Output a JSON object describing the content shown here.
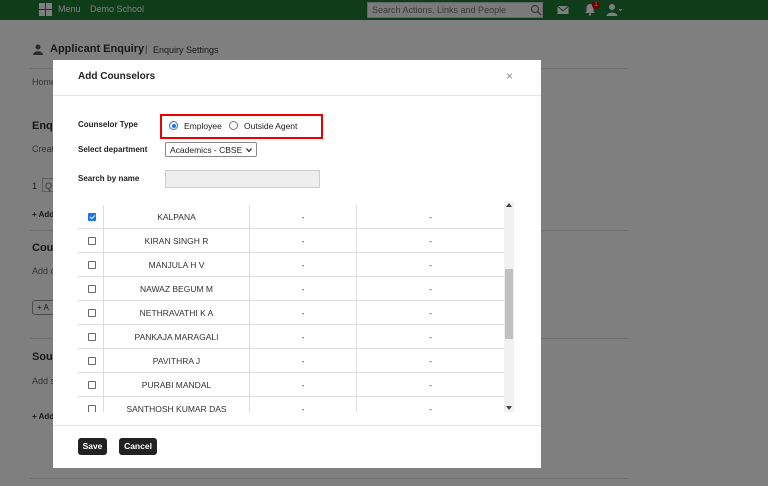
{
  "topbar": {
    "menu_label": "Menu",
    "school_name": "Demo School",
    "search_placeholder": "Search Actions, Links and People",
    "notification_count": "1",
    "accent_color": "#1e7a32"
  },
  "background": {
    "page_title": "Applicant Enquiry",
    "separator": "|",
    "page_subtitle": "Enquiry Settings",
    "breadcrumb": "Home",
    "section1_heading": "Enqu",
    "section1_text": "Creat",
    "row_number": "1",
    "row_box_text": "Q",
    "add_link1": "+ Add",
    "section2_heading": "Cour",
    "section2_text": "Add c",
    "button_text": "+ A",
    "section3_heading": "Sour",
    "section3_text": "Add s",
    "add_link2": "+ Add"
  },
  "modal": {
    "title": "Add Counselors",
    "close_symbol": "×",
    "counselor_type_label": "Counselor Type",
    "type_options": [
      {
        "label": "Employee",
        "selected": true
      },
      {
        "label": "Outside Agent",
        "selected": false
      }
    ],
    "department_label": "Select department",
    "department_value": "Academics - CBSE",
    "search_label": "Search by name",
    "search_value": "",
    "rows": [
      {
        "name": "KALPANA",
        "col2": "-",
        "col3": "-",
        "checked": true
      },
      {
        "name": "KIRAN SINGH R",
        "col2": "-",
        "col3": "-",
        "checked": false
      },
      {
        "name": "MANJULA H V",
        "col2": "-",
        "col3": "-",
        "checked": false
      },
      {
        "name": "NAWAZ BEGUM M",
        "col2": "-",
        "col3": "-",
        "checked": false
      },
      {
        "name": "NETHRAVATHI K A",
        "col2": "-",
        "col3": "-",
        "checked": false
      },
      {
        "name": "PANKAJA MARAGALI",
        "col2": "-",
        "col3": "-",
        "checked": false
      },
      {
        "name": "PAVITHRA J",
        "col2": "-",
        "col3": "-",
        "checked": false
      },
      {
        "name": "PURABI MANDAL",
        "col2": "-",
        "col3": "-",
        "checked": false
      },
      {
        "name": "SANTHOSH KUMAR DAS",
        "col2": "-",
        "col3": "-",
        "checked": false
      }
    ],
    "save_label": "Save",
    "cancel_label": "Cancel",
    "highlight_color": "#e00000",
    "check_color": "#1a73e8"
  }
}
